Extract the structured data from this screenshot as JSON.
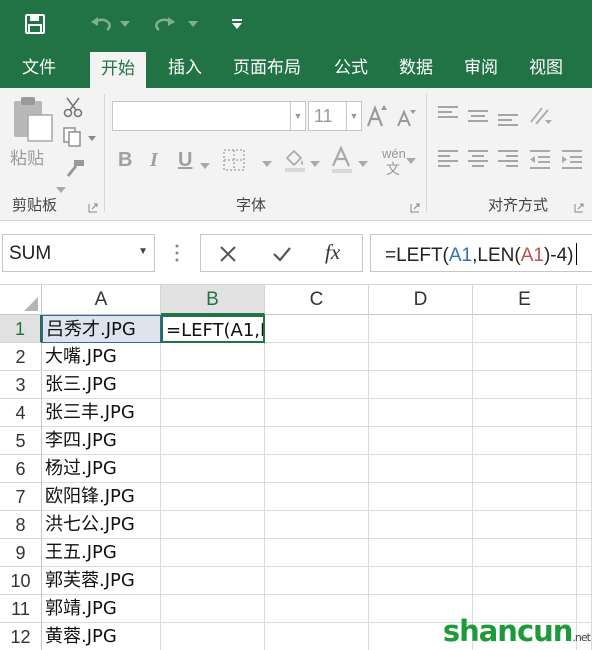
{
  "tabs": [
    {
      "label": "文件"
    },
    {
      "label": "开始"
    },
    {
      "label": "插入"
    },
    {
      "label": "页面布局"
    },
    {
      "label": "公式"
    },
    {
      "label": "数据"
    },
    {
      "label": "审阅"
    },
    {
      "label": "视图"
    }
  ],
  "ribbon": {
    "clipboard": {
      "paste_label": "粘贴",
      "group_label": "剪贴板"
    },
    "font": {
      "font_size": "11",
      "bold": "B",
      "italic": "I",
      "underline": "U",
      "phonetic": "wén",
      "group_label": "字体"
    },
    "alignment": {
      "group_label": "对齐方式"
    }
  },
  "formula_bar": {
    "name_box": "SUM",
    "fx": "fx",
    "formula": {
      "p1": "=LEFT(",
      "ref1": "A1",
      "p2": ",LEN(",
      "ref2": "A1",
      "p3": ")-4)"
    }
  },
  "grid": {
    "columns": [
      "A",
      "B",
      "C",
      "D",
      "E"
    ],
    "selected_column": "B",
    "rows": [
      {
        "num": "1",
        "a": "吕秀才.JPG",
        "b": "=LEFT(A1,L"
      },
      {
        "num": "2",
        "a": "大嘴.JPG"
      },
      {
        "num": "3",
        "a": "张三.JPG"
      },
      {
        "num": "4",
        "a": "张三丰.JPG"
      },
      {
        "num": "5",
        "a": "李四.JPG"
      },
      {
        "num": "6",
        "a": "杨过.JPG"
      },
      {
        "num": "7",
        "a": "欧阳锋.JPG"
      },
      {
        "num": "8",
        "a": "洪七公.JPG"
      },
      {
        "num": "9",
        "a": "王五.JPG"
      },
      {
        "num": "10",
        "a": "郭芙蓉.JPG"
      },
      {
        "num": "11",
        "a": "郭靖.JPG"
      },
      {
        "num": "12",
        "a": "黄蓉.JPG"
      }
    ]
  },
  "colors": {
    "accent": "#217346",
    "ref_blue": "#2e74b5",
    "ref_red": "#c0504d"
  },
  "watermark": {
    "text": "shancun",
    "suffix": ".net"
  }
}
